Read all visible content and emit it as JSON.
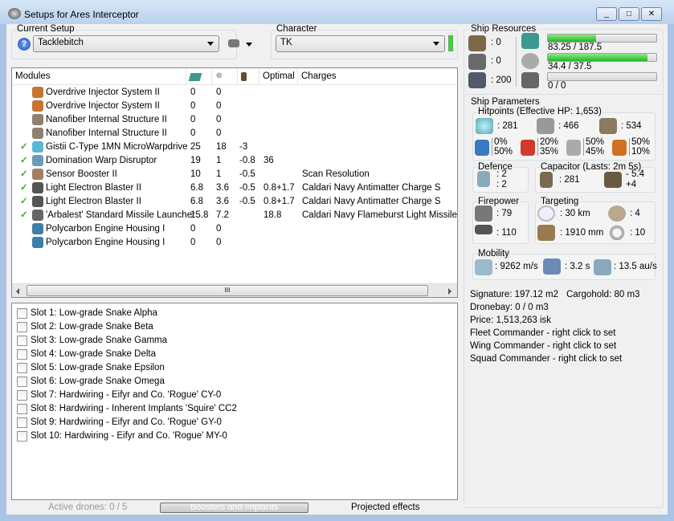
{
  "window": {
    "title": "Setups for Ares Interceptor",
    "minimize": "0",
    "maximize": "1",
    "close": "r"
  },
  "setup": {
    "label": "Current Setup",
    "value": "Tacklebitch",
    "help_icon": "question-icon",
    "ship_icon": "ship-menu-icon"
  },
  "character": {
    "label": "Character",
    "value": "TK",
    "status_color": "#00ff00"
  },
  "modules": {
    "headers": {
      "name": "Modules",
      "cpu_icon": "cpu-icon",
      "pg_icon": "powergrid-icon",
      "cap_icon": "capacitor-icon",
      "optimal": "Optimal",
      "charges": "Charges"
    },
    "rows": [
      {
        "active": false,
        "name": "Overdrive Injector System II",
        "cpu": "0",
        "pg": "0",
        "cap": "",
        "optimal": "",
        "charges": "",
        "color": "#c8742f"
      },
      {
        "active": false,
        "name": "Overdrive Injector System II",
        "cpu": "0",
        "pg": "0",
        "cap": "",
        "optimal": "",
        "charges": "",
        "color": "#c8742f"
      },
      {
        "active": false,
        "name": "Nanofiber Internal Structure II",
        "cpu": "0",
        "pg": "0",
        "cap": "",
        "optimal": "",
        "charges": "",
        "color": "#8d8070"
      },
      {
        "active": false,
        "name": "Nanofiber Internal Structure II",
        "cpu": "0",
        "pg": "0",
        "cap": "",
        "optimal": "",
        "charges": "",
        "color": "#8d8070"
      },
      {
        "active": true,
        "name": "Gistii C-Type 1MN MicroWarpdrive",
        "cpu": "25",
        "pg": "18",
        "cap": "-3",
        "optimal": "",
        "charges": "",
        "color": "#5bb6d6"
      },
      {
        "active": true,
        "name": "Domination Warp Disruptor",
        "cpu": "19",
        "pg": "1",
        "cap": "-0.8",
        "optimal": "36",
        "charges": "",
        "color": "#6c9bb8"
      },
      {
        "active": true,
        "name": "Sensor Booster II",
        "cpu": "10",
        "pg": "1",
        "cap": "-0.5",
        "optimal": "",
        "charges": "Scan Resolution",
        "color": "#a08060"
      },
      {
        "active": true,
        "name": "Light Electron Blaster II",
        "cpu": "6.8",
        "pg": "3.6",
        "cap": "-0.5",
        "optimal": "0.8+1.7",
        "charges": "Caldari Navy Antimatter Charge S",
        "color": "#555"
      },
      {
        "active": true,
        "name": "Light Electron Blaster II",
        "cpu": "6.8",
        "pg": "3.6",
        "cap": "-0.5",
        "optimal": "0.8+1.7",
        "charges": "Caldari Navy Antimatter Charge S",
        "color": "#555"
      },
      {
        "active": true,
        "name": "'Arbalest' Standard Missile Launcher",
        "cpu": "15.8",
        "pg": "7.2",
        "cap": "",
        "optimal": "18.8",
        "charges": "Caldari Navy Flameburst Light Missile",
        "color": "#666"
      },
      {
        "active": false,
        "name": "Polycarbon Engine Housing I",
        "cpu": "0",
        "pg": "0",
        "cap": "",
        "optimal": "",
        "charges": "",
        "color": "#3d7fa8"
      },
      {
        "active": false,
        "name": "Polycarbon Engine Housing I",
        "cpu": "0",
        "pg": "0",
        "cap": "",
        "optimal": "",
        "charges": "",
        "color": "#3d7fa8"
      }
    ],
    "scroll_grip": "III"
  },
  "implants": [
    "Slot 1: Low-grade Snake Alpha",
    "Slot 2: Low-grade Snake Beta",
    "Slot 3: Low-grade Snake Gamma",
    "Slot 4: Low-grade Snake Delta",
    "Slot 5: Low-grade Snake Epsilon",
    "Slot 6: Low-grade Snake Omega",
    "Slot 7: Hardwiring - Eifyr and Co. 'Rogue' CY-0",
    "Slot 8: Hardwiring - Inherent Implants 'Squire' CC2",
    "Slot 9: Hardwiring - Eifyr and Co. 'Rogue' GY-0",
    "Slot 10: Hardwiring - Eifyr and Co. 'Rogue' MY-0"
  ],
  "bottom": {
    "drones": "Active drones: 0 / 5",
    "boosters": "Boosters and Implants",
    "projected": "Projected effects"
  },
  "resources": {
    "label": "Ship Resources",
    "turret": ": 0",
    "launcher": ": 0",
    "calibration": ": 200",
    "cpu": {
      "text": "83.25 / 187.5",
      "fraction": 0.444
    },
    "powergrid": {
      "text": "34.4 / 37.5",
      "fraction": 0.917
    },
    "drone_bw": {
      "text": "0 / 0",
      "fraction": 0
    }
  },
  "params": {
    "label": "Ship Parameters",
    "hp": {
      "label": "Hitpoints (Effective HP: 1,653)",
      "shield": ": 281",
      "armor": ": 466",
      "structure": ": 534",
      "resists": [
        {
          "icon": "em-icon",
          "a": "0%",
          "b": "50%"
        },
        {
          "icon": "thermal-icon",
          "a": "20%",
          "b": "35%"
        },
        {
          "icon": "kinetic-icon",
          "a": "50%",
          "b": "45%"
        },
        {
          "icon": "explosive-icon",
          "a": "50%",
          "b": "10%"
        }
      ]
    },
    "defence": {
      "label": "Defence",
      "a": ": 2",
      "b": ": 2"
    },
    "capacitor": {
      "label": "Capacitor (Lasts: 2m 5s)",
      "amount": ": 281",
      "use": "- 5.4",
      "regen": "+4"
    },
    "firepower": {
      "label": "Firepower",
      "dps": ": 79",
      "volley": ": 110"
    },
    "targeting": {
      "label": "Targeting",
      "range": ": 30 km",
      "targets": ": 4",
      "resolution": ": 1910 mm",
      "sensor": ": 10"
    },
    "mobility": {
      "label": "Mobility",
      "speed": ": 9262 m/s",
      "align": ": 3.2 s",
      "warp": ": 13.5 au/s"
    }
  },
  "stats": [
    "Signature: 197.12 m2",
    "Cargohold: 80 m3",
    "Dronebay: 0 / 0 m3",
    "Price: 1,513,263 isk",
    "Fleet Commander - right click to set",
    "Wing Commander - right click to set",
    "Squad Commander - right click to set"
  ]
}
